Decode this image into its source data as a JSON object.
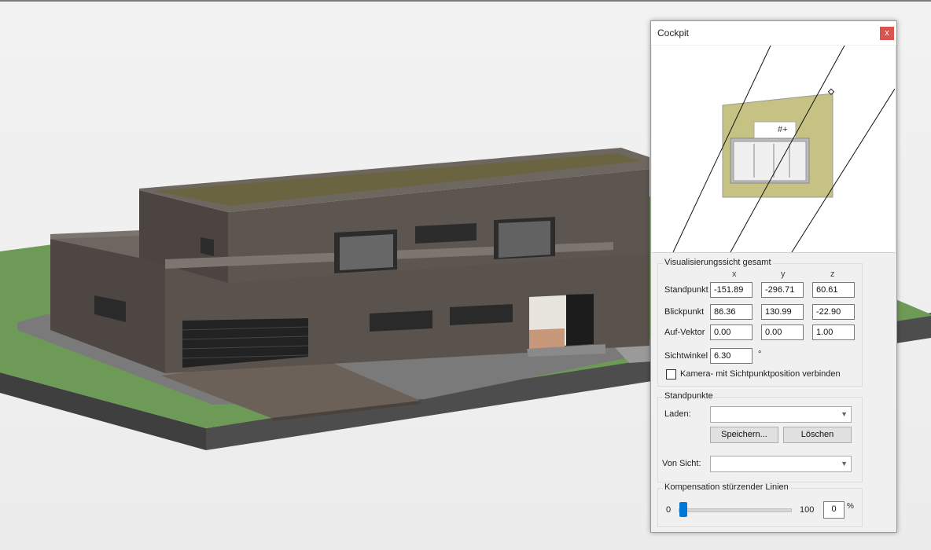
{
  "window": {
    "title": "Cockpit",
    "close_label": "x"
  },
  "visualisation": {
    "group_title": "Visualisierungssicht gesamt",
    "columns": [
      "x",
      "y",
      "z"
    ],
    "standpunkt": {
      "label": "Standpunkt",
      "x": "-151.89",
      "y": "-296.71",
      "z": "60.61"
    },
    "blickpunkt": {
      "label": "Blickpunkt",
      "x": "86.36",
      "y": "130.99",
      "z": "-22.90"
    },
    "auf_vektor": {
      "label": "Auf-Vektor",
      "x": "0.00",
      "y": "0.00",
      "z": "1.00"
    },
    "sichtwinkel": {
      "label": "Sichtwinkel",
      "value": "6.30",
      "unit": "°"
    },
    "camera_link": {
      "label": "Kamera- mit Sichtpunktposition verbinden",
      "checked": false
    }
  },
  "standpunkte": {
    "group_title": "Standpunkte",
    "laden_label": "Laden:",
    "laden_value": "",
    "save_label": "Speichern...",
    "delete_label": "Löschen",
    "von_sicht_label": "Von Sicht:",
    "von_sicht_value": ""
  },
  "kompensation": {
    "group_title": "Kompensation stürzender Linien",
    "min_label": "0",
    "max_label": "100",
    "value": "0",
    "unit": "%",
    "slider_fraction": 0
  },
  "colors": {
    "close_button": "#d9534f",
    "slider_accent": "#0078d7",
    "ground": "#6e9a57",
    "wall": "#58504a",
    "roof_green": "#6a6540",
    "plot_fill": "#c5c283"
  },
  "icons": {
    "close": "close-icon",
    "dropdown": "chevron-down-icon"
  }
}
